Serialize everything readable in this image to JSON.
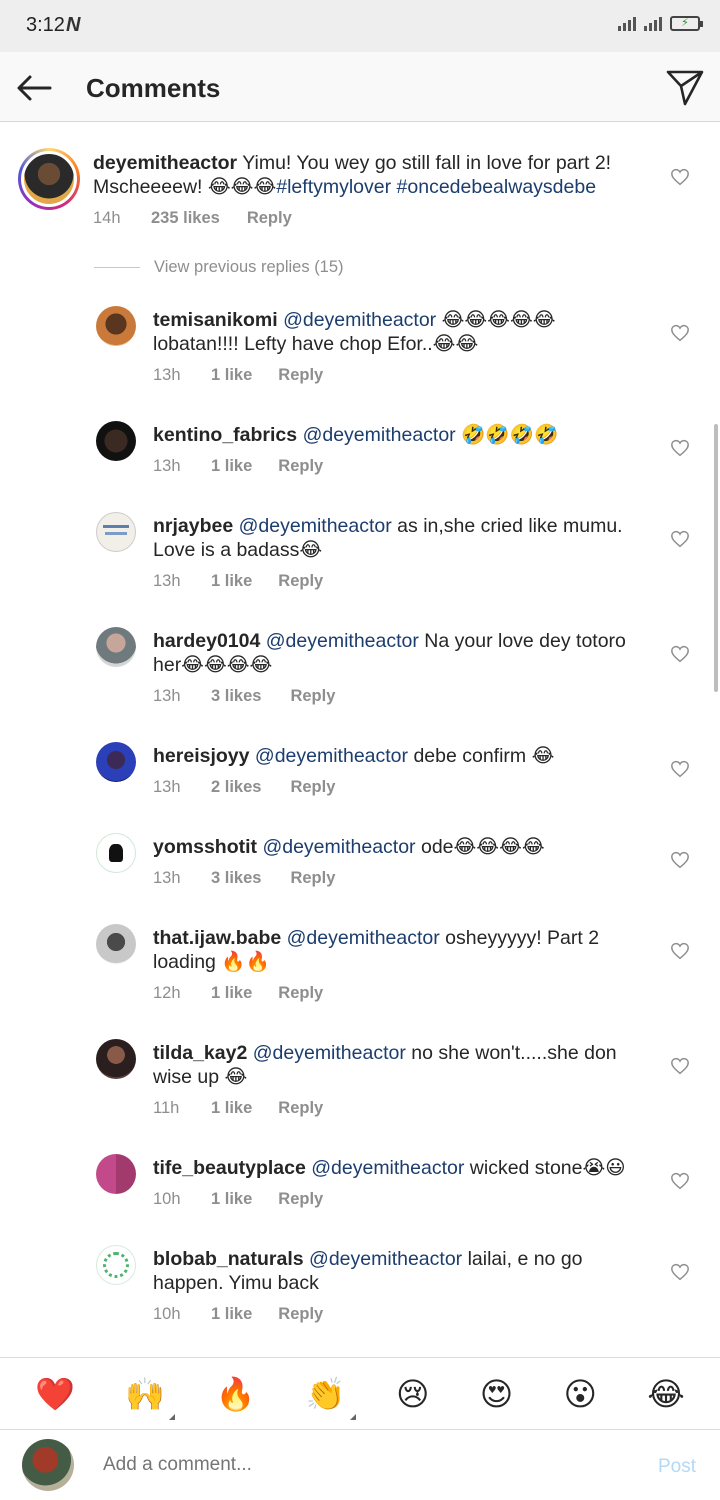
{
  "status_bar": {
    "time": "3:12",
    "app_badge": "N",
    "battery": "⚡"
  },
  "header": {
    "title": "Comments"
  },
  "top_comment": {
    "username": "deyemitheactor",
    "text": "Yimu! You wey go still fall in love for part 2! Mscheeeew! 😂😂😂",
    "tags": [
      "#leftymylover",
      "#oncedebealwaysdebe"
    ],
    "time": "14h",
    "likes": "235 likes",
    "reply": "Reply"
  },
  "view_previous": "View previous replies (15)",
  "replies": [
    {
      "username": "temisanikomi",
      "mention": "@deyemitheactor",
      "text": " 😂😂😂😂😂 lobatan!!!! Lefty have chop Efor..😂😂",
      "time": "13h",
      "likes": "1 like",
      "reply": "Reply"
    },
    {
      "username": "kentino_fabrics",
      "mention": "@deyemitheactor",
      "text": " 🤣🤣🤣🤣",
      "time": "13h",
      "likes": "1 like",
      "reply": "Reply"
    },
    {
      "username": "nrjaybee",
      "mention": "@deyemitheactor",
      "text": " as in,she cried like mumu. Love is a badass😂",
      "time": "13h",
      "likes": "1 like",
      "reply": "Reply"
    },
    {
      "username": "hardey0104",
      "mention": "@deyemitheactor",
      "text": " Na your love dey  totoro her😂😂😂😂",
      "time": "13h",
      "likes": "3 likes",
      "reply": "Reply"
    },
    {
      "username": "hereisjoyy",
      "mention": "@deyemitheactor",
      "text": " debe confirm 😂",
      "time": "13h",
      "likes": "2 likes",
      "reply": "Reply"
    },
    {
      "username": "yomsshotit",
      "mention": "@deyemitheactor",
      "text": " ode😂😂😂😂",
      "time": "13h",
      "likes": "3 likes",
      "reply": "Reply"
    },
    {
      "username": "that.ijaw.babe",
      "mention": "@deyemitheactor",
      "text": " osheyyyyy! Part 2 loading 🔥🔥",
      "time": "12h",
      "likes": "1 like",
      "reply": "Reply"
    },
    {
      "username": "tilda_kay2",
      "mention": "@deyemitheactor",
      "text": " no she won't.....she don wise up 😂",
      "time": "11h",
      "likes": "1 like",
      "reply": "Reply"
    },
    {
      "username": "tife_beautyplace",
      "mention": "@deyemitheactor",
      "text": " wicked stone😭😃",
      "time": "10h",
      "likes": "1 like",
      "reply": "Reply"
    },
    {
      "username": "blobab_naturals",
      "mention": "@deyemitheactor",
      "text": " lailai, e no go happen. Yimu back",
      "time": "10h",
      "likes": "1 like",
      "reply": "Reply"
    }
  ],
  "emoji_bar": [
    "❤️",
    "🙌",
    "🔥",
    "👏",
    "😢",
    "😍",
    "😮",
    "😂"
  ],
  "add_comment": {
    "placeholder": "Add a comment...",
    "post_label": "Post"
  },
  "colors": {
    "mention": "#1c3d6e",
    "meta": "#8e8e8e",
    "post_disabled": "#b2d9f5"
  }
}
